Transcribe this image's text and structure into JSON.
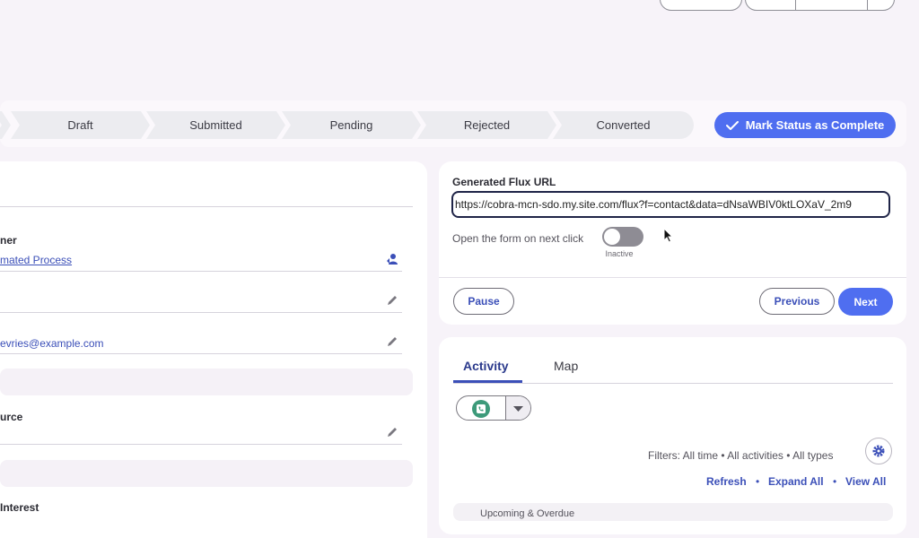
{
  "path": {
    "stages": [
      "Draft",
      "Submitted",
      "Pending",
      "Rejected",
      "Converted"
    ],
    "mark_complete_label": "Mark Status as Complete"
  },
  "record": {
    "owner_label": "ner",
    "owner_value": "mated Process",
    "email_value": "evries@example.com",
    "source_label": "urce",
    "interest_label": "Interest"
  },
  "flux": {
    "title": "Generated Flux URL",
    "url": "https://cobra-mcn-sdo.my.site.com/flux?f=contact&data=dNsaWBIV0ktLOXaV_2m9",
    "open_form_label": "Open the form on next click",
    "toggle_status": "Inactive",
    "toggle_on": false,
    "pause_label": "Pause",
    "previous_label": "Previous",
    "next_label": "Next"
  },
  "activity": {
    "tabs": [
      "Activity",
      "Map"
    ],
    "active_tab": "Activity",
    "filters_text": "Filters: All time • All activities • All types",
    "actions": [
      "Refresh",
      "Expand All",
      "View All"
    ],
    "separator": "•",
    "partial_row_text": "Upcoming & Overdue"
  },
  "colors": {
    "accent": "#4f6ef0",
    "link": "#3b4fb8",
    "activity_icon": "#3d9a7a"
  }
}
